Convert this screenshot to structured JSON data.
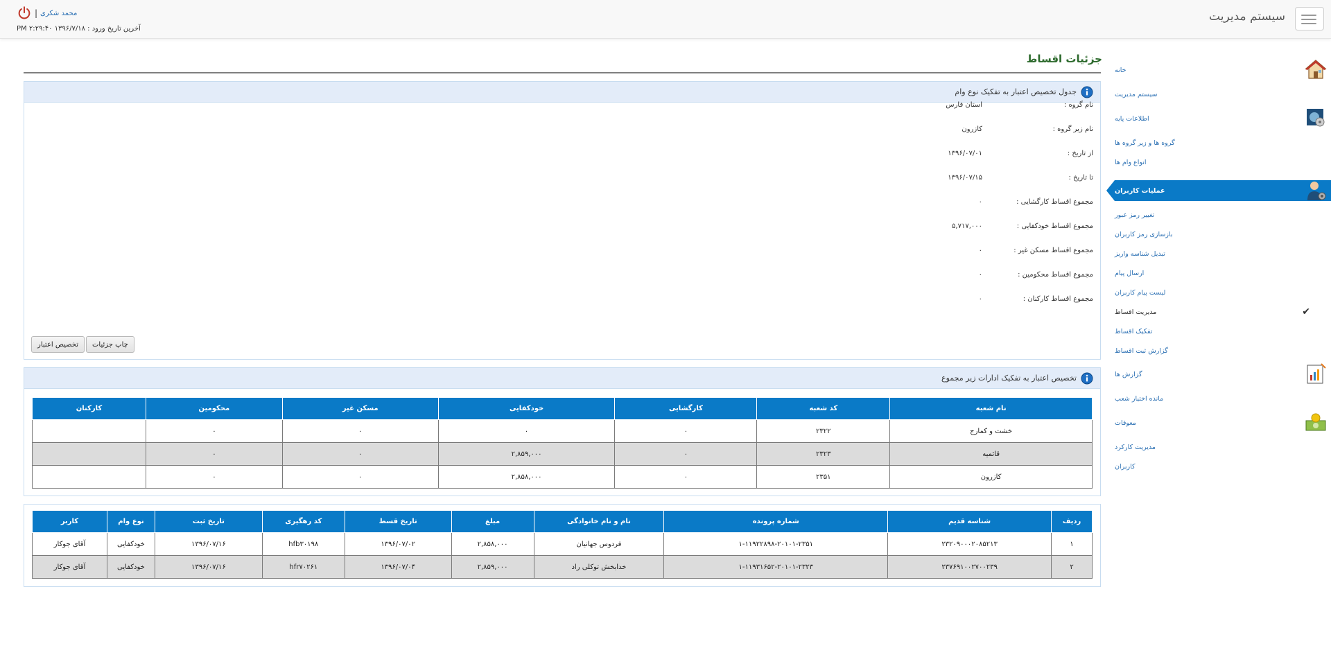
{
  "navbar": {
    "brand": "سیستم مدیریت",
    "user_name": "محمد شکری",
    "separator": "|",
    "last_login": "آخرین تاریخ ورود : ۱۳۹۶/۷/۱۸ ۲:۲۹:۴۰ PM"
  },
  "sidebar": {
    "items": [
      {
        "label": "خانه",
        "icon": "home-icon"
      },
      {
        "label": "سیستم مدیریت"
      },
      {
        "label": "اطلاعات پایه",
        "icon": "database-icon"
      },
      {
        "label": "گروه ها و زیر گروه ها"
      },
      {
        "label": "انواع وام ها"
      },
      {
        "label": "عملیات کاربران",
        "icon": "user-settings-icon"
      },
      {
        "label": "تغییر رمز عبور"
      },
      {
        "label": "بازسازی رمز کاربران"
      },
      {
        "label": "تبدیل شناسه واریز"
      },
      {
        "label": "ارسال پیام"
      },
      {
        "label": "لیست پیام کاربران"
      },
      {
        "label": "مدیریت اقساط"
      },
      {
        "label": "تفکیک اقساط"
      },
      {
        "label": "گزارش ثبت اقساط"
      },
      {
        "label": "گزارش ها",
        "icon": "report-icon"
      },
      {
        "label": "مانده اختیار شعب"
      },
      {
        "label": "معوقات",
        "icon": "money-icon"
      },
      {
        "label": "مدیریت کارکرد"
      },
      {
        "label": "کاربران"
      }
    ]
  },
  "page": {
    "title": "جزئیات اقساط"
  },
  "panel1": {
    "title": "جدول تخصیص اعتبار به تفکیک نوع وام",
    "fields": [
      {
        "label": "نام گروه :",
        "value": "استان فارس"
      },
      {
        "label": "نام زیر گروه :",
        "value": "کازرون"
      },
      {
        "label": "از تاریخ :",
        "value": "۱۳۹۶/۰۷/۰۱"
      },
      {
        "label": "تا تاریخ :",
        "value": "۱۳۹۶/۰۷/۱۵"
      },
      {
        "label": "مجموع اقساط کارگشایی :",
        "value": "۰"
      },
      {
        "label": "مجموع اقساط خودکفایی :",
        "value": "۵,۷۱۷,۰۰۰"
      },
      {
        "label": "مجموع اقساط مسکن غیر :",
        "value": "۰"
      },
      {
        "label": "مجموع اقساط محکومین :",
        "value": "۰"
      },
      {
        "label": "مجموع اقساط کارکنان :",
        "value": "۰"
      }
    ],
    "print_button": "چاپ جزئیات",
    "allocate_button": "تخصیص اعتبار"
  },
  "panel2": {
    "title": "تخصیص اعتبار به تفکیک ادارات زیر مجموع",
    "headers": [
      "نام شعبه",
      "کد شعبه",
      "کارگشایی",
      "خودکفایی",
      "مسکن غیر",
      "محکومین",
      "کارکنان"
    ],
    "rows": [
      [
        "خشت و کمارج",
        "۲۳۲۲",
        "۰",
        "۰",
        "۰",
        "۰",
        ""
      ],
      [
        "قائمیه",
        "۲۳۲۳",
        "۰",
        "۲,۸۵۹,۰۰۰",
        "۰",
        "۰",
        ""
      ],
      [
        "کازرون",
        "۲۳۵۱",
        "۰",
        "۲,۸۵۸,۰۰۰",
        "۰",
        "۰",
        ""
      ]
    ]
  },
  "panel3": {
    "headers": [
      "ردیف",
      "شناسه قدیم",
      "شماره پرونده",
      "نام و نام خانوادگی",
      "مبلغ",
      "تاریخ قسط",
      "کد رهگیری",
      "تاریخ ثبت",
      "نوع وام",
      "کاربر"
    ],
    "rows": [
      [
        "۱",
        "۲۳۲۰۹۰۰۰۲۰۸۵۲۱۳",
        "۱-۱۱۹۲۲۸۹۸-۲۰۱۰۱-۲۳۵۱",
        "فردوس جهانیان",
        "۲,۸۵۸,۰۰۰",
        "۱۳۹۶/۰۷/۰۲",
        "hfb۳۰۱۹۸",
        "۱۳۹۶/۰۷/۱۶",
        "خودکفایی",
        "آقای جوکار"
      ],
      [
        "۲",
        "۲۳۷۶۹۱۰۰۲۷۰۰۲۳۹",
        "۱-۱۱۹۳۱۶۵۲-۲۰۱۰۱-۲۳۲۳",
        "خدابخش توکلی راد",
        "۲,۸۵۹,۰۰۰",
        "۱۳۹۶/۰۷/۰۴",
        "hfr۷۰۲۶۱",
        "۱۳۹۶/۰۷/۱۶",
        "خودکفایی",
        "آقای جوکار"
      ]
    ]
  },
  "colors": {
    "primary": "#0a7ac7",
    "panel_header": "#e3ecf9",
    "title_green": "#2d6a2d",
    "link": "#2a6fb3"
  }
}
